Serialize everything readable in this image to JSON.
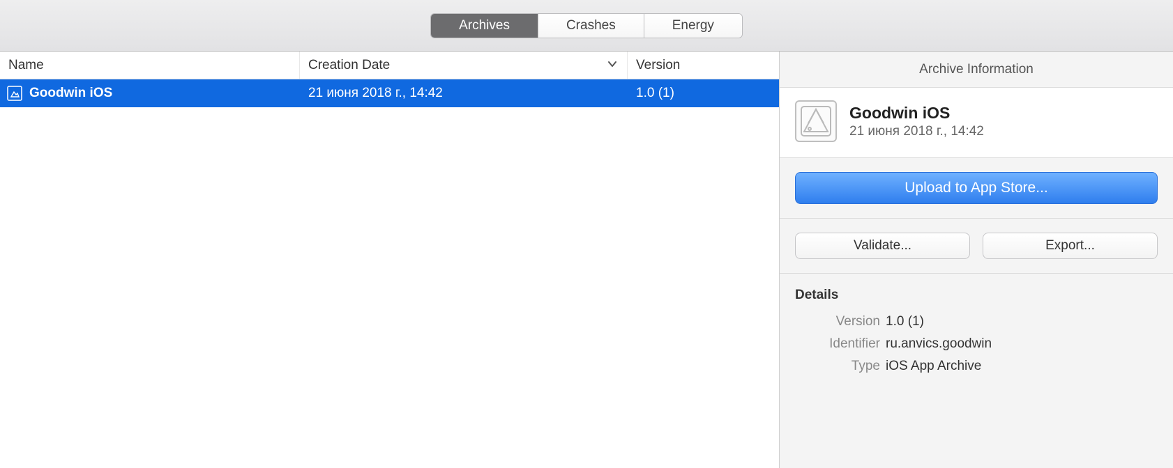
{
  "tabs": {
    "archives": "Archives",
    "crashes": "Crashes",
    "energy": "Energy",
    "active": "archives"
  },
  "columns": {
    "name": "Name",
    "creation_date": "Creation Date",
    "version": "Version"
  },
  "rows": [
    {
      "name": "Goodwin iOS",
      "date": "21 июня 2018 г., 14:42",
      "version": "1.0 (1)",
      "selected": true
    }
  ],
  "info": {
    "panel_title": "Archive Information",
    "app_name": "Goodwin iOS",
    "app_date": "21 июня 2018 г., 14:42",
    "upload_label": "Upload to App Store...",
    "validate_label": "Validate...",
    "export_label": "Export...",
    "details_heading": "Details",
    "version_label": "Version",
    "version_value": "1.0 (1)",
    "identifier_label": "Identifier",
    "identifier_value": "ru.anvics.goodwin",
    "type_label": "Type",
    "type_value": "iOS App Archive"
  }
}
